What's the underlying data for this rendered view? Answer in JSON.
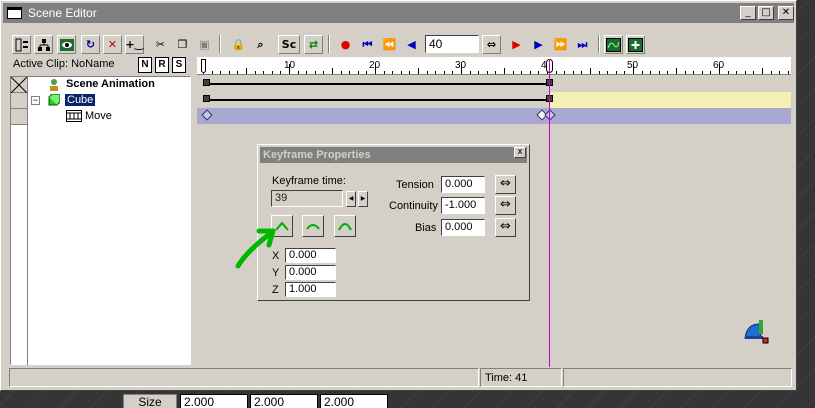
{
  "window": {
    "title": "Scene Editor"
  },
  "titlebar_buttons": {
    "minimize": "_",
    "maximize": "□",
    "close": "✕"
  },
  "toolbar": {
    "icons": [
      "properties",
      "hierarchy",
      "scene",
      "refresh",
      "delete",
      "insert",
      "cut",
      "copy",
      "paste",
      "lock",
      "zoom-fit"
    ],
    "sc_label": "Sc",
    "frame_value": "40",
    "playback": [
      "record",
      "go-start",
      "prev-key",
      "step-back",
      "step-forward",
      "play",
      "next-key",
      "go-end"
    ]
  },
  "clip": {
    "active_label": "Active Clip: NoName",
    "buttons": [
      "N",
      "R",
      "S"
    ]
  },
  "tree": {
    "root": "Scene Animation",
    "node": "Cube",
    "child": "Move"
  },
  "ruler": {
    "labels": [
      "10",
      "20",
      "30",
      "40",
      "50",
      "60"
    ],
    "current_frame": 41
  },
  "keyframe_dialog": {
    "title": "Keyframe Properties",
    "close": "x",
    "time_label": "Keyframe time:",
    "time_value": "39",
    "tension_label": "Tension",
    "tension_value": "0.000",
    "continuity_label": "Continuity",
    "continuity_value": "-1.000",
    "bias_label": "Bias",
    "bias_value": "0.000",
    "x_label": "X",
    "x_value": "0.000",
    "y_label": "Y",
    "y_value": "0.000",
    "z_label": "Z",
    "z_value": "1.000",
    "swap_glyph": "⇔"
  },
  "status": {
    "time": "Time: 41"
  },
  "bottom": {
    "size_label": "Size",
    "values": [
      "2.000",
      "2.000",
      "2.000"
    ]
  },
  "colors": {
    "track_highlight": "#f4efb4",
    "track_selected": "#a8a8d0",
    "playhead": "#cc00cc",
    "accent_green": "#00b800"
  }
}
